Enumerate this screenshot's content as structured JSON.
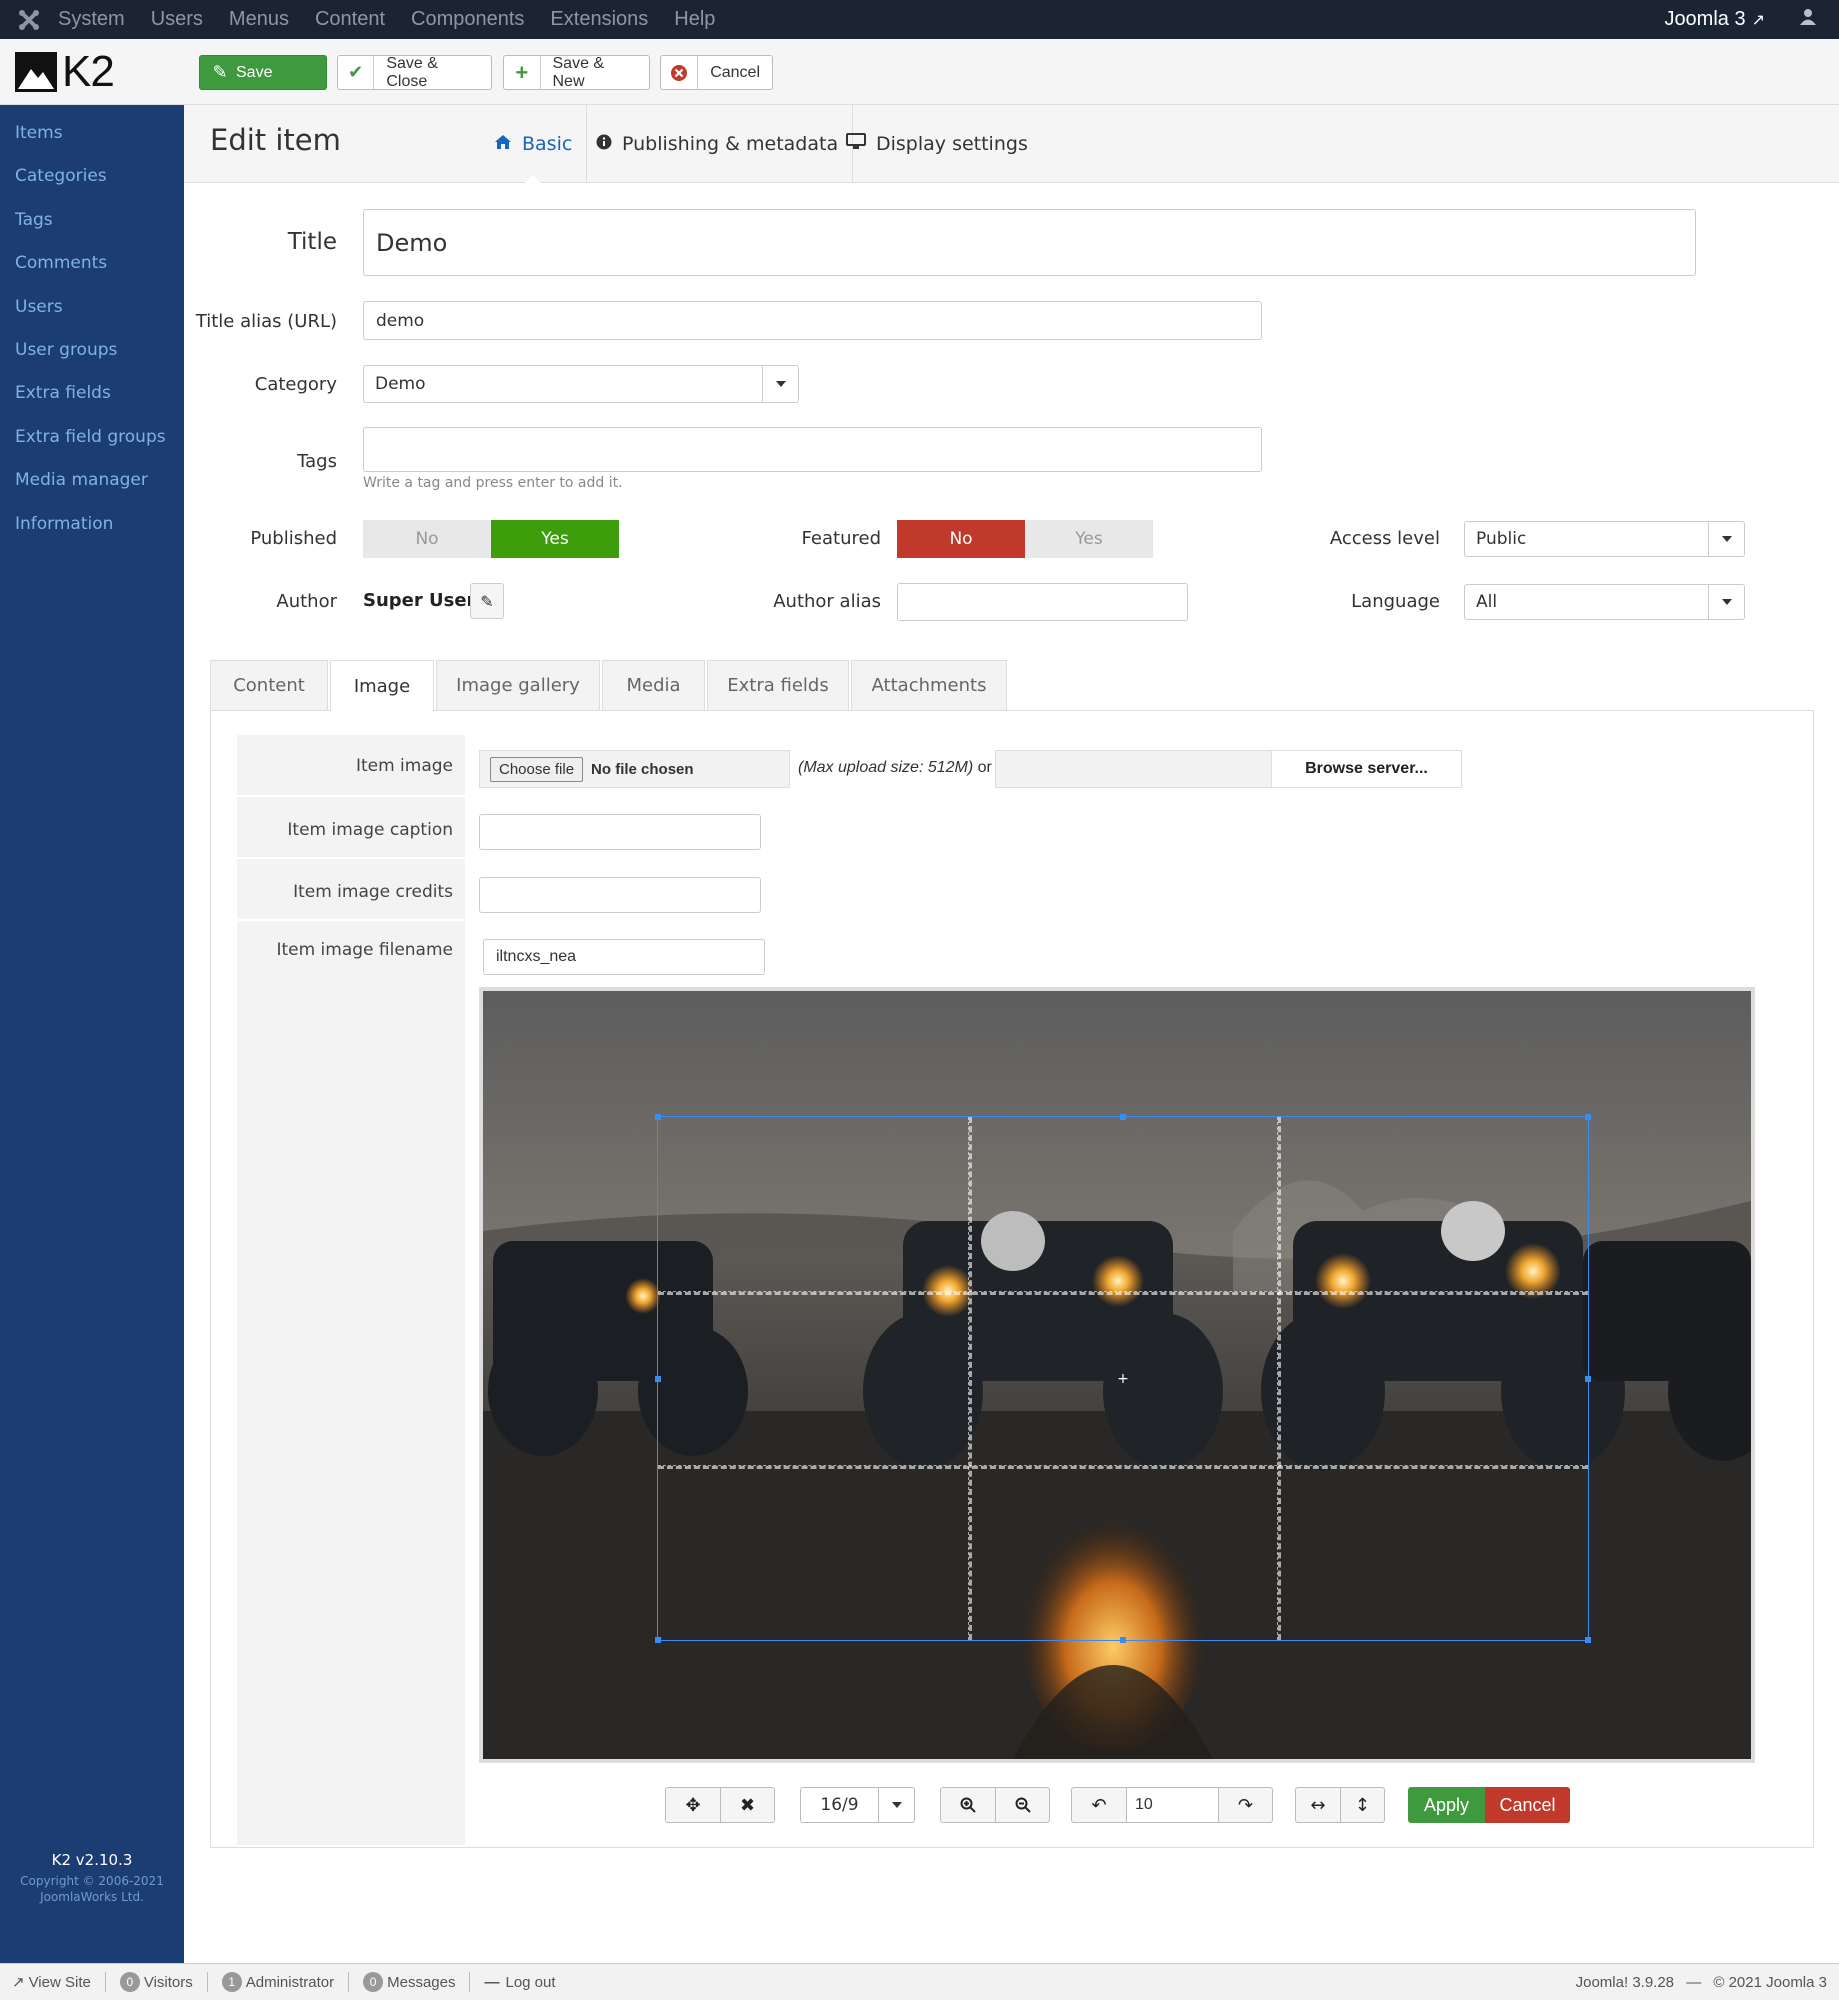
{
  "topbar": {
    "menu": [
      "System",
      "Users",
      "Menus",
      "Content",
      "Components",
      "Extensions",
      "Help"
    ],
    "site_link": "Joomla 3"
  },
  "toolbar": {
    "save_label": "Save",
    "save_close_label": "Save & Close",
    "save_new_label": "Save & New",
    "cancel_label": "Cancel"
  },
  "brand": {
    "logo_text": "K2"
  },
  "sidebar": {
    "items": [
      "Items",
      "Categories",
      "Tags",
      "Comments",
      "Users",
      "User groups",
      "Extra fields",
      "Extra field groups",
      "Media manager",
      "Information"
    ],
    "version": "K2 v2.10.3",
    "copyright_line1": "Copyright © 2006-2021",
    "copyright_line2": "JoomlaWorks Ltd."
  },
  "page": {
    "title": "Edit item",
    "tabs": [
      "Basic",
      "Publishing & metadata",
      "Display settings"
    ]
  },
  "form": {
    "title_label": "Title",
    "title_value": "Demo",
    "alias_label": "Title alias (URL)",
    "alias_value": "demo",
    "category_label": "Category",
    "category_value": "Demo",
    "tags_label": "Tags",
    "tags_hint": "Write a tag and press enter to add it.",
    "published_label": "Published",
    "published_no": "No",
    "published_yes": "Yes",
    "featured_label": "Featured",
    "featured_no": "No",
    "featured_yes": "Yes",
    "access_label": "Access level",
    "access_value": "Public",
    "author_label": "Author",
    "author_value": "Super User",
    "author_alias_label": "Author alias",
    "language_label": "Language",
    "language_value": "All"
  },
  "inner_tabs": [
    "Content",
    "Image",
    "Image gallery",
    "Media",
    "Extra fields",
    "Attachments"
  ],
  "image_tab": {
    "item_image_label": "Item image",
    "choose_file": "Choose file",
    "no_file": "No file chosen",
    "max_upload": "(Max upload size: 512M)",
    "or": "or",
    "browse_server": "Browse server...",
    "caption_label": "Item image caption",
    "credits_label": "Item image credits",
    "filename_label": "Item image filename",
    "filename_value": "iltncxs_nea"
  },
  "crop_toolbar": {
    "aspect_ratio": "16/9",
    "rotate_value": "10",
    "apply_label": "Apply",
    "cancel_label": "Cancel"
  },
  "statusbar": {
    "view_site": "View Site",
    "visitors_count": "0",
    "visitors_label": "Visitors",
    "admin_count": "1",
    "admin_label": "Administrator",
    "messages_count": "0",
    "messages_label": "Messages",
    "logout": "Log out",
    "version": "Joomla! 3.9.28",
    "dash": "—",
    "copyright": "© 2021 Joomla 3"
  },
  "colors": {
    "topbar_bg": "#1a2433",
    "sidebar_bg": "#1c3d73",
    "save_green": "#3f9a3f",
    "toggle_yes": "#3e9d0b",
    "toggle_no": "#c0392b",
    "crop_blue": "#3a8cf0"
  }
}
